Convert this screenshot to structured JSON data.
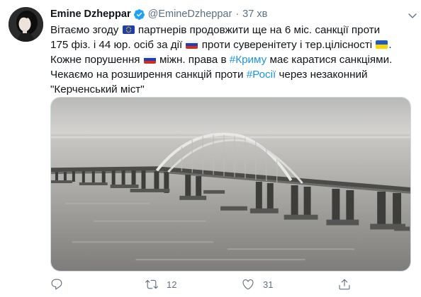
{
  "tweet": {
    "author_name": "Emine Dzheppar",
    "handle": "@EmineDzheppar",
    "separator": "·",
    "time": "37 хв",
    "text": {
      "l1_a": "Вітаємо згоду",
      "l1_b": "партнерів продовжити ще на 6 міс. санкції проти",
      "l2_a": "175 фіз. і 44 юр. осіб за дії",
      "l2_b": "проти суверенітету і тер.цілісності",
      "l2_c": ".",
      "l3_a": "Кожне порушення",
      "l3_b": "міжн. права в",
      "l3_hashtag": "#Криму",
      "l3_c": "має каратися санкціями.",
      "l4_a": "Чекаємо на розширення санкцій проти",
      "l4_hashtag": "#Росії",
      "l4_b": "через незаконний",
      "l5": "\"Керченський міст\""
    },
    "flags": [
      "eu-flag-icon",
      "russia-flag-icon",
      "ukraine-flag-icon"
    ],
    "media": "photo of Crimean (Kerch) Bridge arches over sea",
    "actions": {
      "reply_count": "",
      "retweet_count": "12",
      "like_count": "31"
    }
  },
  "colors": {
    "text": "#0f1419",
    "secondary": "#5b7083",
    "hashtag": "#1b95e0",
    "verified": "#1da1f2"
  }
}
